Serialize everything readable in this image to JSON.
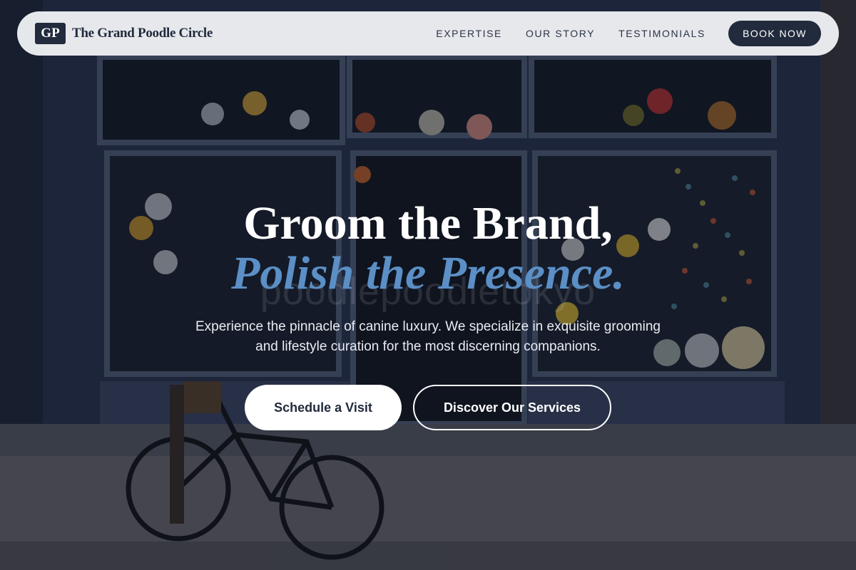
{
  "brand": {
    "logo_text": "GP",
    "name": "The Grand Poodle Circle"
  },
  "nav": {
    "links": [
      {
        "label": "EXPERTISE"
      },
      {
        "label": "OUR STORY"
      },
      {
        "label": "TESTIMONIALS"
      }
    ],
    "cta_label": "BOOK NOW"
  },
  "hero": {
    "title_line1": "Groom the Brand,",
    "title_line2": "Polish the Presence.",
    "background_sign_text": "poodlepoodletokyo",
    "subtitle": "Experience the pinnacle of canine luxury. We specialize in exquisite grooming and lifestyle curation for the most discerning companions.",
    "primary_button": "Schedule a Visit",
    "secondary_button": "Discover Our Services"
  },
  "colors": {
    "navy": "#222b3d",
    "accent_blue": "#5b8fc6",
    "nav_bg": "#eef0f4"
  }
}
